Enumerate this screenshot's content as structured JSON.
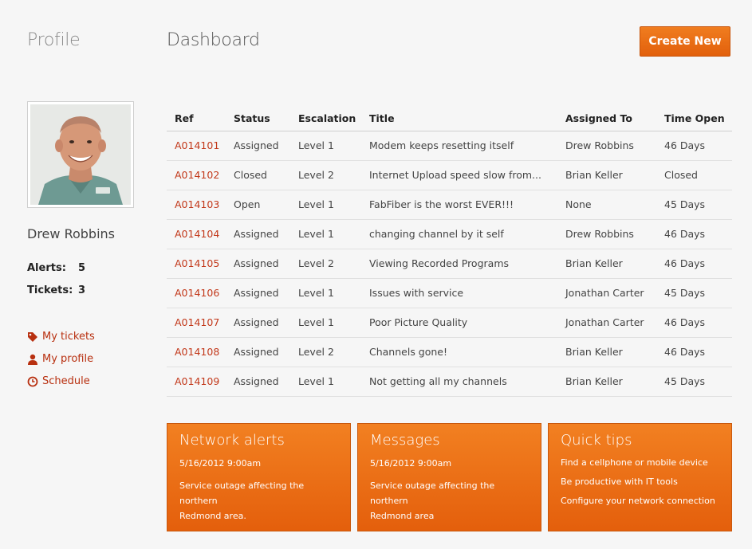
{
  "profile": {
    "title": "Profile",
    "user_name": "Drew Robbins",
    "alerts_label": "Alerts:",
    "alerts_value": "5",
    "tickets_label": "Tickets:",
    "tickets_value": "3",
    "links": [
      {
        "label": "My tickets",
        "icon": "tag-icon"
      },
      {
        "label": "My profile",
        "icon": "person-icon"
      },
      {
        "label": "Schedule",
        "icon": "clock-icon"
      }
    ]
  },
  "dashboard": {
    "title": "Dashboard",
    "create_label": "Create New"
  },
  "table": {
    "headers": [
      "Ref",
      "Status",
      "Escalation",
      "Title",
      "Assigned To",
      "Time Open"
    ],
    "rows": [
      [
        "A014101",
        "Assigned",
        "Level 1",
        "Modem keeps resetting itself",
        "Drew Robbins",
        "46 Days"
      ],
      [
        "A014102",
        "Closed",
        "Level 2",
        "Internet Upload speed slow from...",
        "Brian Keller",
        "Closed"
      ],
      [
        "A014103",
        "Open",
        "Level 1",
        "FabFiber is the worst EVER!!!",
        "None",
        "45 Days"
      ],
      [
        "A014104",
        "Assigned",
        "Level 1",
        "changing channel by it self",
        "Drew Robbins",
        "46 Days"
      ],
      [
        "A014105",
        "Assigned",
        "Level 2",
        "Viewing Recorded Programs",
        "Brian Keller",
        "46 Days"
      ],
      [
        "A014106",
        "Assigned",
        "Level 1",
        "Issues with service",
        "Jonathan Carter",
        "45 Days"
      ],
      [
        "A014107",
        "Assigned",
        "Level 1",
        "Poor Picture Quality",
        "Jonathan Carter",
        "46 Days"
      ],
      [
        "A014108",
        "Assigned",
        "Level 2",
        "Channels gone!",
        "Brian Keller",
        "46 Days"
      ],
      [
        "A014109",
        "Assigned",
        "Level 1",
        "Not getting all my channels",
        "Brian Keller",
        "45 Days"
      ]
    ]
  },
  "tiles": {
    "network": {
      "title": "Network alerts",
      "date": "5/16/2012 9:00am",
      "body_1": "Service outage affecting the northern",
      "body_2": "Redmond area."
    },
    "messages": {
      "title": "Messages",
      "date": "5/16/2012 9:00am",
      "body_1": "Service outage affecting the northern",
      "body_2": "Redmond area"
    },
    "tips": {
      "title": "Quick tips",
      "items": [
        "Find a cellphone or mobile device",
        "Be productive with IT tools",
        "Configure your network connection"
      ]
    }
  },
  "colors": {
    "accent": "#e8690f",
    "link": "#b83010",
    "ref": "#c2381a"
  }
}
